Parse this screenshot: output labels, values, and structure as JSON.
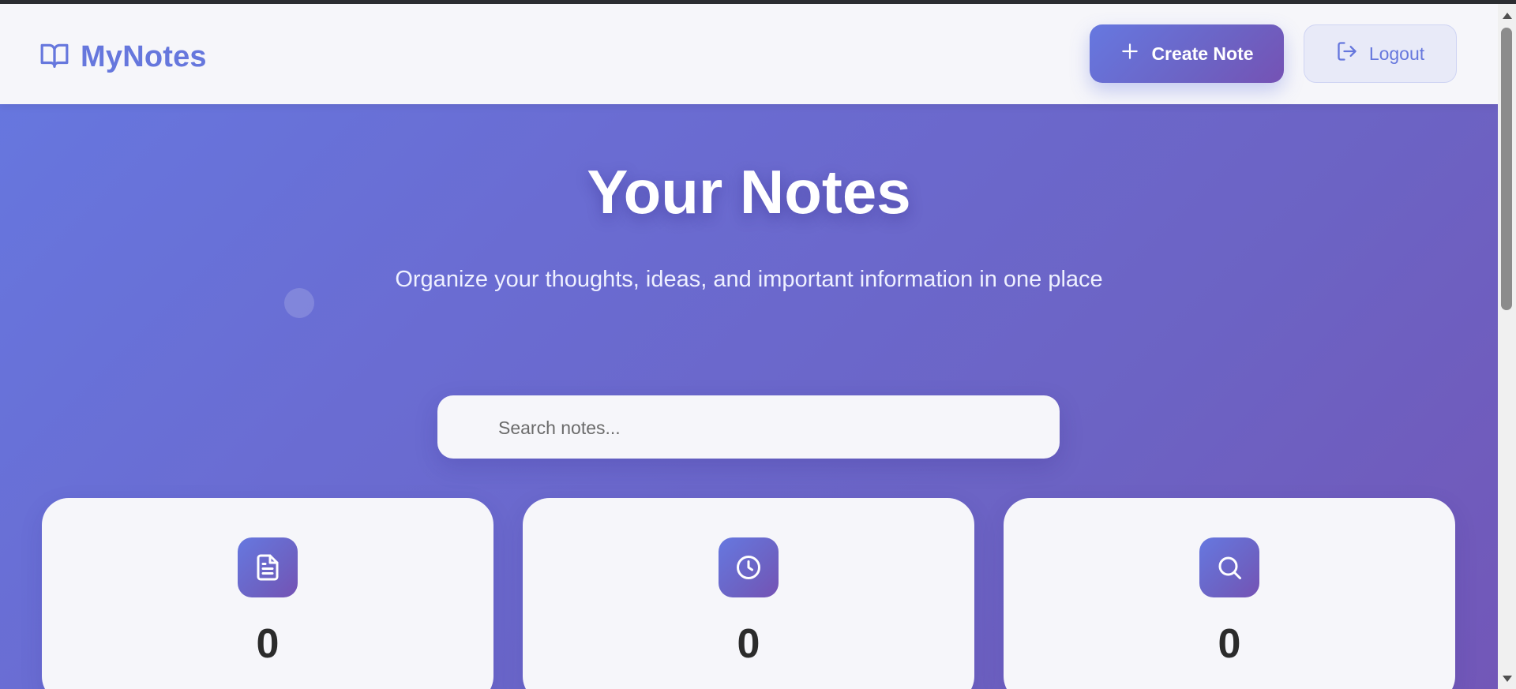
{
  "header": {
    "brand_name": "MyNotes",
    "brand_icon": "book-open-icon",
    "create_label": "Create Note",
    "create_icon": "plus-icon",
    "logout_label": "Logout",
    "logout_icon": "logout-icon"
  },
  "hero": {
    "title": "Your Notes",
    "subtitle": "Organize your thoughts, ideas, and important information in one place"
  },
  "search": {
    "placeholder": "Search notes...",
    "value": ""
  },
  "stats": [
    {
      "icon": "document-icon",
      "value": "0"
    },
    {
      "icon": "clock-icon",
      "value": "0"
    },
    {
      "icon": "search-icon",
      "value": "0"
    }
  ],
  "colors": {
    "brand": "#6677DD",
    "gradient_start": "#6678E0",
    "gradient_end": "#7552B4",
    "card_bg": "#F6F6FA"
  }
}
